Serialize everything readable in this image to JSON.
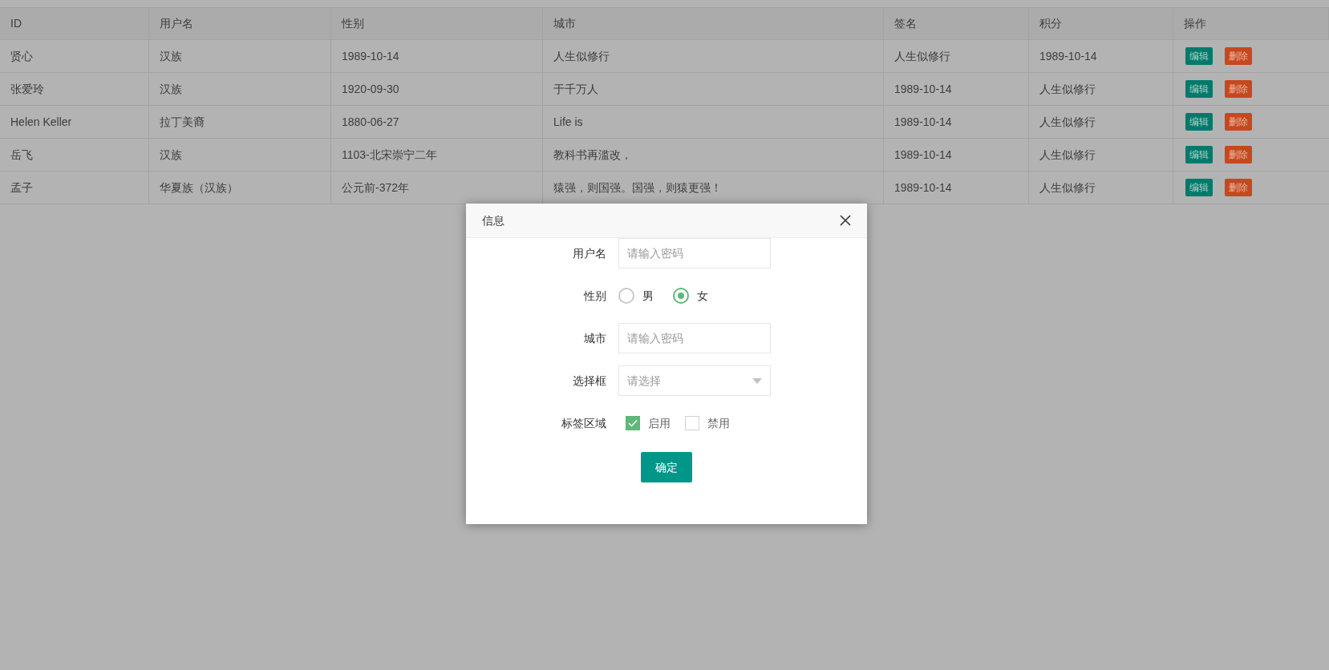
{
  "table": {
    "columns": [
      "ID",
      "用户名",
      "性别",
      "城市",
      "签名",
      "积分",
      "操作"
    ],
    "rows": [
      {
        "cells": [
          "贤心",
          "汉族",
          "1989-10-14",
          "人生似修行",
          "人生似修行",
          "1989-10-14"
        ],
        "actions": [
          "编辑",
          "删除"
        ]
      },
      {
        "cells": [
          "张爱玲",
          "汉族",
          "1920-09-30",
          "于千万人",
          "1989-10-14",
          "人生似修行"
        ],
        "actions": [
          "编辑",
          "删除"
        ]
      },
      {
        "cells": [
          "Helen Keller",
          "拉丁美裔",
          "1880-06-27",
          "Life is",
          "1989-10-14",
          "人生似修行"
        ],
        "actions": [
          "编辑",
          "删除"
        ]
      },
      {
        "cells": [
          "岳飞",
          "汉族",
          "1103-北宋崇宁二年",
          "教科书再滥改，",
          "1989-10-14",
          "人生似修行"
        ],
        "actions": [
          "编辑",
          "删除"
        ]
      },
      {
        "cells": [
          "孟子",
          "华夏族（汉族）",
          "公元前-372年",
          "猿强，则国强。国强，则猿更强！",
          "1989-10-14",
          "人生似修行"
        ],
        "actions": [
          "编辑",
          "删除"
        ]
      }
    ]
  },
  "dialog": {
    "title": "信息",
    "fields": [
      {
        "kind": "text",
        "label": "用户名",
        "placeholder": "请输入密码"
      },
      {
        "kind": "radio",
        "label": "性别",
        "options": [
          {
            "label": "男",
            "selected": false
          },
          {
            "label": "女",
            "selected": true
          }
        ]
      },
      {
        "kind": "text",
        "label": "城市",
        "placeholder": "请输入密码"
      },
      {
        "kind": "select",
        "label": "选择框",
        "placeholder": "请选择"
      },
      {
        "kind": "checkbox",
        "label": "标签区域",
        "options": [
          {
            "label": "启用",
            "checked": true
          },
          {
            "label": "禁用",
            "checked": false
          }
        ]
      }
    ],
    "submit": "确定"
  }
}
